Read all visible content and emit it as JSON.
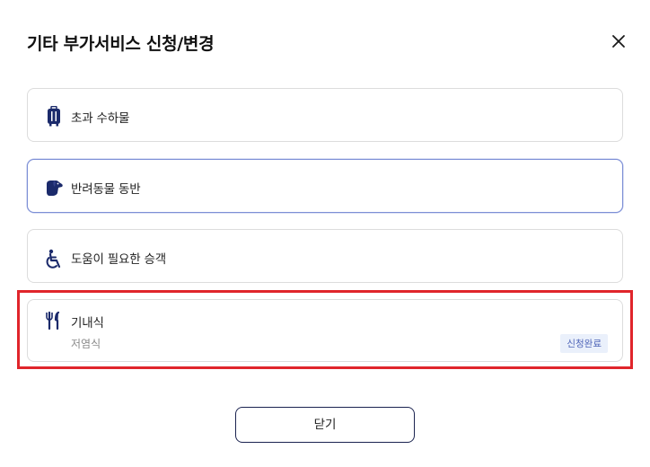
{
  "dialog": {
    "title": "기타 부가서비스 신청/변경",
    "close_icon": "close-icon"
  },
  "services": [
    {
      "label": "초과 수하물",
      "icon": "luggage-icon"
    },
    {
      "label": "반려동물 동반",
      "icon": "dog-icon",
      "selected": true
    },
    {
      "label": "도움이 필요한 승객",
      "icon": "wheelchair-icon"
    },
    {
      "label": "기내식",
      "icon": "meal-icon",
      "detail": "저염식",
      "status": "신청완료"
    }
  ],
  "footer": {
    "close_label": "닫기"
  },
  "colors": {
    "icon": "#1b2a6b",
    "selected_border": "#7d8fd6",
    "highlight": "#e0252b",
    "badge_text": "#4f65b8",
    "badge_bg": "#eaf0fb"
  }
}
